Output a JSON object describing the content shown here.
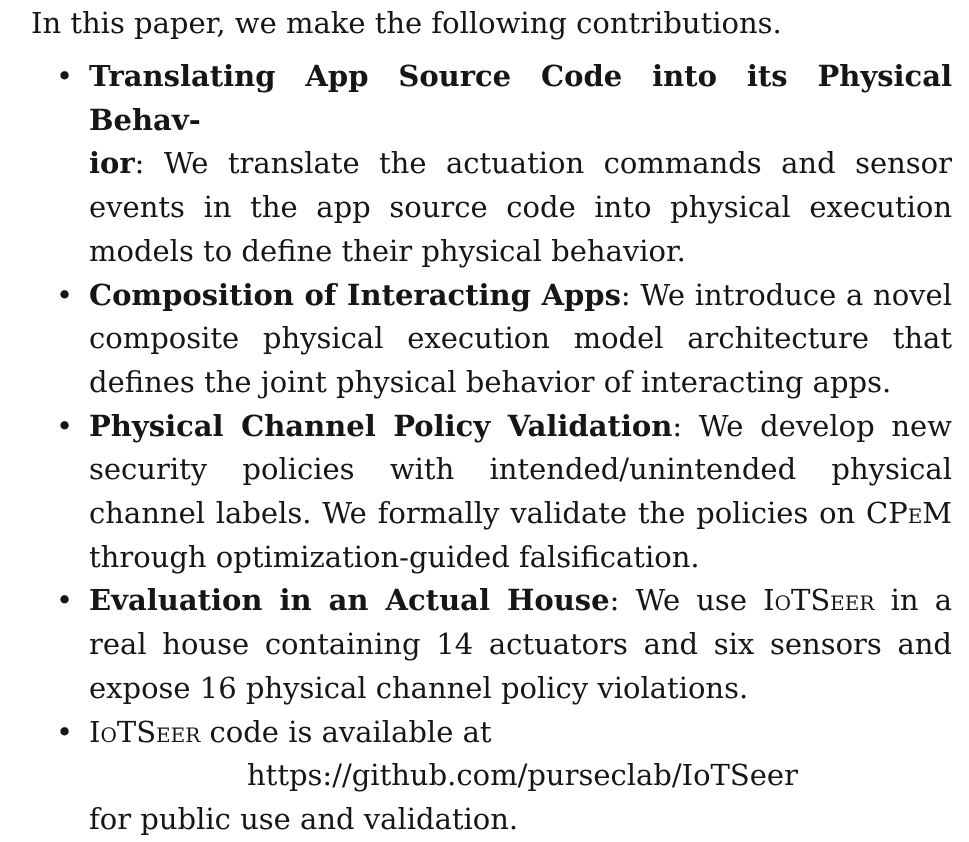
{
  "intro": "In this paper, we make the following contributions.",
  "bullet_glyph": "•",
  "contributions": [
    {
      "title": "Translating App Source Code into its Physical Behav-ior",
      "title_part1": "Translating App Source Code into its Physical Behav-",
      "title_part2": "ior",
      "body": ": We translate the actuation commands and sensor events in the app source code into physical execution models to define their physical behavior."
    },
    {
      "title": "Composition of Interacting Apps",
      "body": ": We introduce a novel composite physical execution model architecture that defines the joint physical behavior of interacting apps."
    },
    {
      "title": "Physical Channel Policy Validation",
      "body_before_sc": ": We develop new security policies with intended/unintended physical channel labels. We formally validate the policies on ",
      "sc_term": "CPeM",
      "body_after_sc": " through optimization-guided falsification."
    },
    {
      "title": "Evaluation in an Actual House",
      "body_before_sc": ": We use ",
      "sc_term": "IoTSeer",
      "body_after_sc": " in a real house containing 14 actuators and six sensors and expose 16 physical channel policy violations."
    },
    {
      "sc_term": "IoTSeer",
      "body": " code is available at",
      "url": "https://github.com/purseclab/IoTSeer",
      "trailer": "for public use and validation."
    }
  ]
}
